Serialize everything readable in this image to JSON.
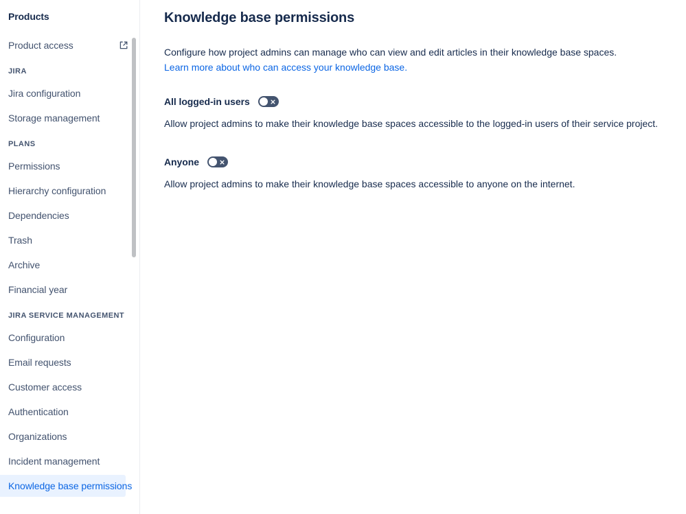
{
  "sidebar": {
    "header": "Products",
    "groups": [
      {
        "label": null,
        "items": [
          {
            "label": "Product access",
            "icon": "external-link-icon",
            "selected": false
          }
        ]
      },
      {
        "label": "JIRA",
        "items": [
          {
            "label": "Jira configuration",
            "selected": false
          },
          {
            "label": "Storage management",
            "selected": false
          }
        ]
      },
      {
        "label": "PLANS",
        "items": [
          {
            "label": "Permissions",
            "selected": false
          },
          {
            "label": "Hierarchy configuration",
            "selected": false
          },
          {
            "label": "Dependencies",
            "selected": false
          },
          {
            "label": "Trash",
            "selected": false
          },
          {
            "label": "Archive",
            "selected": false
          },
          {
            "label": "Financial year",
            "selected": false
          }
        ]
      },
      {
        "label": "JIRA SERVICE MANAGEMENT",
        "items": [
          {
            "label": "Configuration",
            "selected": false
          },
          {
            "label": "Email requests",
            "selected": false
          },
          {
            "label": "Customer access",
            "selected": false
          },
          {
            "label": "Authentication",
            "selected": false
          },
          {
            "label": "Organizations",
            "selected": false
          },
          {
            "label": "Incident management",
            "selected": false
          },
          {
            "label": "Knowledge base permissions",
            "selected": true
          }
        ]
      }
    ]
  },
  "main": {
    "title": "Knowledge base permissions",
    "description": "Configure how project admins can manage who can view and edit articles in their knowledge base spaces.",
    "link_text": "Learn more about who can access your knowledge base.",
    "settings": [
      {
        "title": "All logged-in users",
        "toggle_state": "off",
        "description": "Allow project admins to make their knowledge base spaces accessible to the logged-in users of their service project."
      },
      {
        "title": "Anyone",
        "toggle_state": "off",
        "description": "Allow project admins to make their knowledge base spaces accessible to anyone on the internet."
      }
    ]
  },
  "colors": {
    "accent_blue": "#0c66e4",
    "selected_bg": "#e9f2ff",
    "text_dark": "#172b4d",
    "text_slate": "#42526e",
    "toggle_off": "#44546f"
  }
}
